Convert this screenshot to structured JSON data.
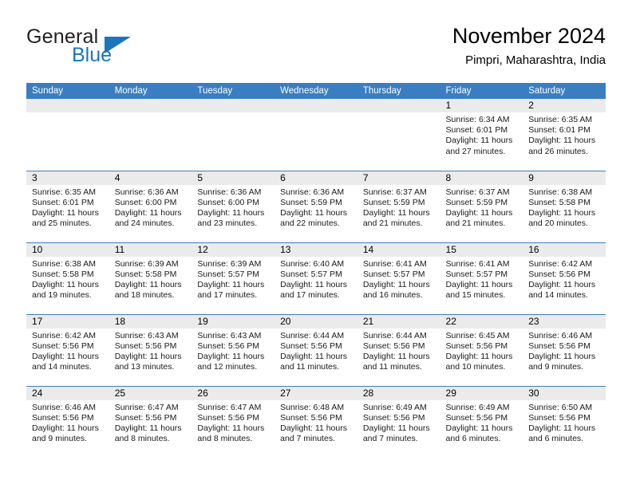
{
  "brand": {
    "word_one": "General",
    "word_two": "Blue",
    "triangle_icon": "triangle-logo-icon",
    "colors": {
      "blue": "#1b75bc",
      "dark": "#231f20"
    }
  },
  "header": {
    "title": "November 2024",
    "subtitle": "Pimpri, Maharashtra, India"
  },
  "theme": {
    "header_blue": "#3a7ec1",
    "row_divider_blue": "#3a7ec1",
    "daynum_band": "#ebebeb"
  },
  "weekdays": [
    "Sunday",
    "Monday",
    "Tuesday",
    "Wednesday",
    "Thursday",
    "Friday",
    "Saturday"
  ],
  "weeks": [
    [
      {
        "day": "",
        "lines": []
      },
      {
        "day": "",
        "lines": []
      },
      {
        "day": "",
        "lines": []
      },
      {
        "day": "",
        "lines": []
      },
      {
        "day": "",
        "lines": []
      },
      {
        "day": "1",
        "lines": [
          "Sunrise: 6:34 AM",
          "Sunset: 6:01 PM",
          "Daylight: 11 hours and 27 minutes."
        ]
      },
      {
        "day": "2",
        "lines": [
          "Sunrise: 6:35 AM",
          "Sunset: 6:01 PM",
          "Daylight: 11 hours and 26 minutes."
        ]
      }
    ],
    [
      {
        "day": "3",
        "lines": [
          "Sunrise: 6:35 AM",
          "Sunset: 6:01 PM",
          "Daylight: 11 hours and 25 minutes."
        ]
      },
      {
        "day": "4",
        "lines": [
          "Sunrise: 6:36 AM",
          "Sunset: 6:00 PM",
          "Daylight: 11 hours and 24 minutes."
        ]
      },
      {
        "day": "5",
        "lines": [
          "Sunrise: 6:36 AM",
          "Sunset: 6:00 PM",
          "Daylight: 11 hours and 23 minutes."
        ]
      },
      {
        "day": "6",
        "lines": [
          "Sunrise: 6:36 AM",
          "Sunset: 5:59 PM",
          "Daylight: 11 hours and 22 minutes."
        ]
      },
      {
        "day": "7",
        "lines": [
          "Sunrise: 6:37 AM",
          "Sunset: 5:59 PM",
          "Daylight: 11 hours and 21 minutes."
        ]
      },
      {
        "day": "8",
        "lines": [
          "Sunrise: 6:37 AM",
          "Sunset: 5:59 PM",
          "Daylight: 11 hours and 21 minutes."
        ]
      },
      {
        "day": "9",
        "lines": [
          "Sunrise: 6:38 AM",
          "Sunset: 5:58 PM",
          "Daylight: 11 hours and 20 minutes."
        ]
      }
    ],
    [
      {
        "day": "10",
        "lines": [
          "Sunrise: 6:38 AM",
          "Sunset: 5:58 PM",
          "Daylight: 11 hours and 19 minutes."
        ]
      },
      {
        "day": "11",
        "lines": [
          "Sunrise: 6:39 AM",
          "Sunset: 5:58 PM",
          "Daylight: 11 hours and 18 minutes."
        ]
      },
      {
        "day": "12",
        "lines": [
          "Sunrise: 6:39 AM",
          "Sunset: 5:57 PM",
          "Daylight: 11 hours and 17 minutes."
        ]
      },
      {
        "day": "13",
        "lines": [
          "Sunrise: 6:40 AM",
          "Sunset: 5:57 PM",
          "Daylight: 11 hours and 17 minutes."
        ]
      },
      {
        "day": "14",
        "lines": [
          "Sunrise: 6:41 AM",
          "Sunset: 5:57 PM",
          "Daylight: 11 hours and 16 minutes."
        ]
      },
      {
        "day": "15",
        "lines": [
          "Sunrise: 6:41 AM",
          "Sunset: 5:57 PM",
          "Daylight: 11 hours and 15 minutes."
        ]
      },
      {
        "day": "16",
        "lines": [
          "Sunrise: 6:42 AM",
          "Sunset: 5:56 PM",
          "Daylight: 11 hours and 14 minutes."
        ]
      }
    ],
    [
      {
        "day": "17",
        "lines": [
          "Sunrise: 6:42 AM",
          "Sunset: 5:56 PM",
          "Daylight: 11 hours and 14 minutes."
        ]
      },
      {
        "day": "18",
        "lines": [
          "Sunrise: 6:43 AM",
          "Sunset: 5:56 PM",
          "Daylight: 11 hours and 13 minutes."
        ]
      },
      {
        "day": "19",
        "lines": [
          "Sunrise: 6:43 AM",
          "Sunset: 5:56 PM",
          "Daylight: 11 hours and 12 minutes."
        ]
      },
      {
        "day": "20",
        "lines": [
          "Sunrise: 6:44 AM",
          "Sunset: 5:56 PM",
          "Daylight: 11 hours and 11 minutes."
        ]
      },
      {
        "day": "21",
        "lines": [
          "Sunrise: 6:44 AM",
          "Sunset: 5:56 PM",
          "Daylight: 11 hours and 11 minutes."
        ]
      },
      {
        "day": "22",
        "lines": [
          "Sunrise: 6:45 AM",
          "Sunset: 5:56 PM",
          "Daylight: 11 hours and 10 minutes."
        ]
      },
      {
        "day": "23",
        "lines": [
          "Sunrise: 6:46 AM",
          "Sunset: 5:56 PM",
          "Daylight: 11 hours and 9 minutes."
        ]
      }
    ],
    [
      {
        "day": "24",
        "lines": [
          "Sunrise: 6:46 AM",
          "Sunset: 5:56 PM",
          "Daylight: 11 hours and 9 minutes."
        ]
      },
      {
        "day": "25",
        "lines": [
          "Sunrise: 6:47 AM",
          "Sunset: 5:56 PM",
          "Daylight: 11 hours and 8 minutes."
        ]
      },
      {
        "day": "26",
        "lines": [
          "Sunrise: 6:47 AM",
          "Sunset: 5:56 PM",
          "Daylight: 11 hours and 8 minutes."
        ]
      },
      {
        "day": "27",
        "lines": [
          "Sunrise: 6:48 AM",
          "Sunset: 5:56 PM",
          "Daylight: 11 hours and 7 minutes."
        ]
      },
      {
        "day": "28",
        "lines": [
          "Sunrise: 6:49 AM",
          "Sunset: 5:56 PM",
          "Daylight: 11 hours and 7 minutes."
        ]
      },
      {
        "day": "29",
        "lines": [
          "Sunrise: 6:49 AM",
          "Sunset: 5:56 PM",
          "Daylight: 11 hours and 6 minutes."
        ]
      },
      {
        "day": "30",
        "lines": [
          "Sunrise: 6:50 AM",
          "Sunset: 5:56 PM",
          "Daylight: 11 hours and 6 minutes."
        ]
      }
    ]
  ]
}
